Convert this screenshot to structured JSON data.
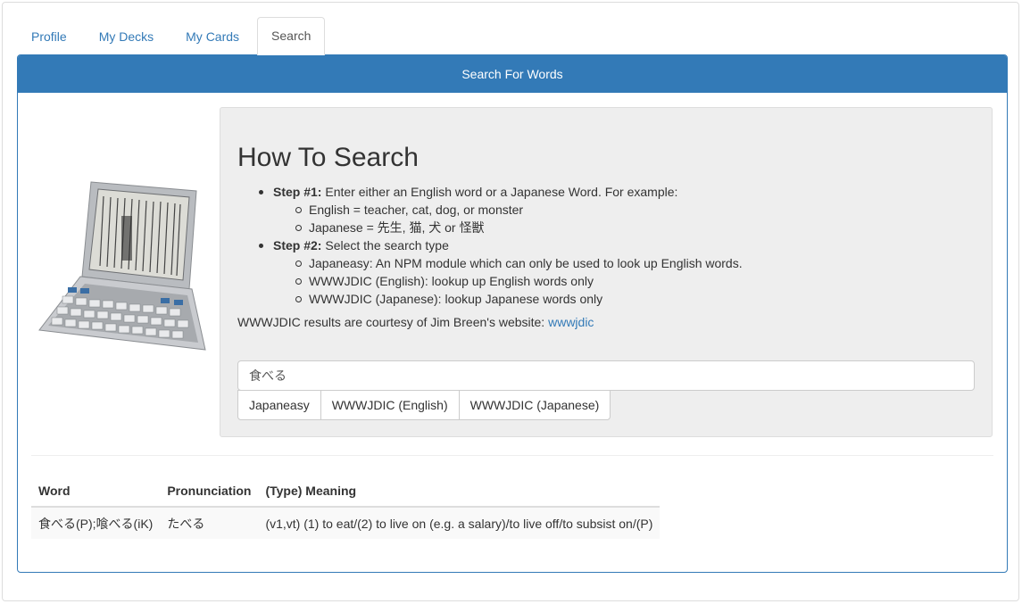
{
  "tabs": [
    {
      "label": "Profile",
      "active": false
    },
    {
      "label": "My Decks",
      "active": false
    },
    {
      "label": "My Cards",
      "active": false
    },
    {
      "label": "Search",
      "active": true
    }
  ],
  "panel": {
    "heading": "Search For Words"
  },
  "image": {
    "icon": "electronic-dictionary-device-icon"
  },
  "howto": {
    "title": "How To Search",
    "step1": {
      "label": "Step #1:",
      "text": " Enter either an English word or a Japanese Word. For example:",
      "items": [
        "English = teacher, cat, dog, or monster",
        "Japanese = 先生, 猫, 犬 or 怪獣"
      ]
    },
    "step2": {
      "label": "Step #2:",
      "text": " Select the search type",
      "items": [
        "Japaneasy: An NPM module which can only be used to look up English words.",
        "WWWJDIC (English): lookup up English words only",
        "WWWJDIC (Japanese): lookup Japanese words only"
      ]
    },
    "credit_text": "WWWJDIC results are courtesy of Jim Breen's website: ",
    "credit_link": "wwwjdic"
  },
  "search": {
    "value": "食べる",
    "buttons": [
      "Japaneasy",
      "WWWJDIC (English)",
      "WWWJDIC (Japanese)"
    ]
  },
  "results": {
    "headers": [
      "Word",
      "Pronunciation",
      "(Type) Meaning"
    ],
    "rows": [
      [
        "食べる(P);喰べる(iK)",
        "たべる",
        "(v1,vt) (1) to eat/(2) to live on (e.g. a salary)/to live off/to subsist on/(P)"
      ]
    ]
  },
  "colors": {
    "primary": "#337ab7",
    "jumbotron": "#eeeeee",
    "text": "#333333"
  }
}
